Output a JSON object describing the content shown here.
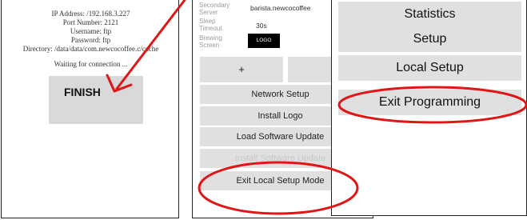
{
  "ftp_panel": {
    "info_lines": [
      "IP Address: /192.168.3.227",
      "Port Number: 2121",
      "Username: ftp",
      "Password: ftp",
      "Directory: /data/data/com.newcocoffee.c/cache"
    ],
    "status": "Waiting for connection ...",
    "finish_label": "FINISH"
  },
  "local_setup": {
    "secondary_server_label_1": "Secondary",
    "secondary_server_label_2": "Server",
    "secondary_server_value": "barista.newcocoffee",
    "sleep_timeout_label_1": "Sleep",
    "sleep_timeout_label_2": "Timeout",
    "sleep_timeout_value": "30s",
    "brewing_screen_label_1": "Brewing",
    "brewing_screen_label_2": "Screen",
    "logo_label": "LOGO",
    "plus_label": "+",
    "minus_label": "-",
    "buttons": [
      "Network Setup",
      "Install Logo",
      "Load Software Update",
      "Install Software Update",
      "Exit Local Setup Mode"
    ]
  },
  "program_menu": {
    "buttons": [
      "Statistics",
      "Setup",
      "Local Setup",
      "Exit Programming"
    ]
  },
  "colors": {
    "annotation_red": "#e01515",
    "button_gray": "#e0e0e0",
    "finish_gray": "#d9d9d9"
  }
}
